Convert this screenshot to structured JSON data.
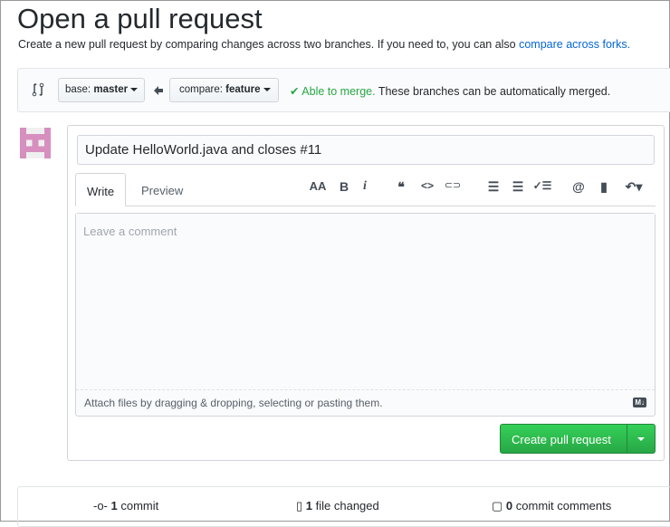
{
  "page": {
    "title": "Open a pull request",
    "subtitle": "Create a new pull request by comparing changes across two branches. If you need to, you can also ",
    "subtitle_link": "compare across forks."
  },
  "compare": {
    "base_label": "base:",
    "base_value": "master",
    "compare_label": "compare:",
    "compare_value": "feature",
    "merge_status": "Able to merge.",
    "merge_message": "These branches can be automatically merged."
  },
  "form": {
    "title_value": "Update HelloWorld.java and closes #11",
    "tabs": [
      "Write",
      "Preview"
    ],
    "comment_placeholder": "Leave a comment",
    "attach_text": "Attach files by dragging & dropping, selecting or pasting them.",
    "markdown_badge": "M↓",
    "submit_label": "Create pull request"
  },
  "toolbar": {
    "heading": "AA",
    "bold": "B",
    "italic": "i",
    "quote": "❝",
    "code": "<>",
    "link": "⊂⊃",
    "ul": "☰",
    "ol": "☰",
    "task": "✓☰",
    "mention": "@",
    "saved": "▮",
    "reply": "↶▾"
  },
  "stats": {
    "commits_count": "1",
    "commits_label": "commit",
    "files_count": "1",
    "files_label": "file changed",
    "comments_count": "0",
    "comments_label": "commit comments"
  },
  "colors": {
    "green": "#28a745",
    "link": "#0366d6"
  }
}
